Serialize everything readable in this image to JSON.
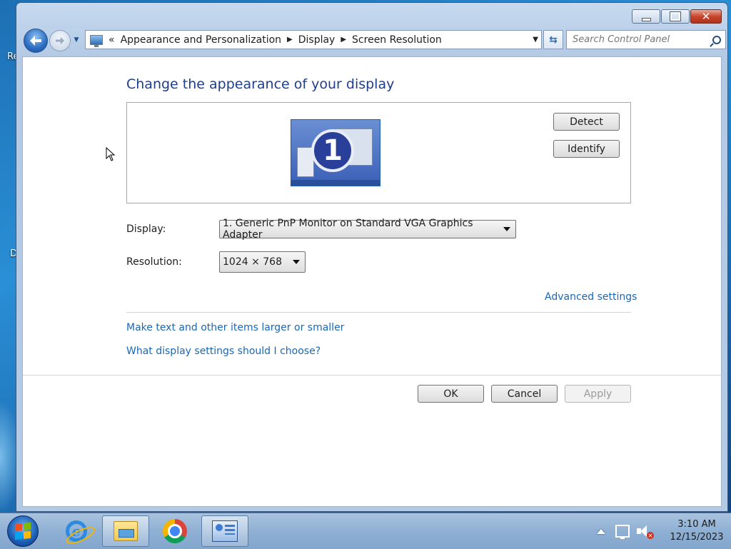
{
  "desktop": {
    "fragments": [
      "Re",
      "D"
    ]
  },
  "window": {
    "breadcrumb": {
      "overflow": "«",
      "items": [
        "Appearance and Personalization",
        "Display",
        "Screen Resolution"
      ]
    },
    "search": {
      "placeholder": "Search Control Panel"
    },
    "icons": {
      "back": "back-arrow-icon",
      "forward": "forward-arrow-icon",
      "refresh": "refresh-icon",
      "search": "search-icon"
    }
  },
  "content": {
    "title": "Change the appearance of your display",
    "monitor_number": "1",
    "detect_label": "Detect",
    "identify_label": "Identify",
    "display_label": "Display:",
    "display_value": "1. Generic PnP Monitor on Standard VGA Graphics Adapter",
    "resolution_label": "Resolution:",
    "resolution_value": "1024 × 768",
    "advanced_link": "Advanced settings",
    "text_size_link": "Make text and other items larger or smaller",
    "help_link": "What display settings should I choose?",
    "ok_label": "OK",
    "cancel_label": "Cancel",
    "apply_label": "Apply"
  },
  "taskbar": {
    "apps": [
      "internet-explorer",
      "windows-explorer",
      "google-chrome",
      "control-panel"
    ],
    "clock_time": "3:10 AM",
    "clock_date": "12/15/2023"
  },
  "colors": {
    "title": "#1e3d8a",
    "link": "#1a67b5",
    "taskbar": "#8fb0d4"
  }
}
